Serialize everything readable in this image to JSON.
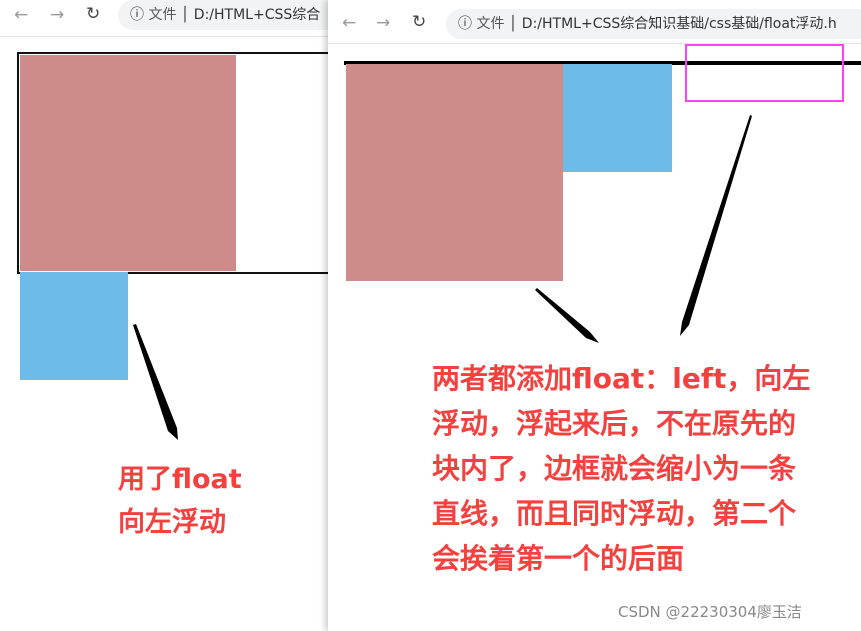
{
  "left_window": {
    "address_label": "文件",
    "address": "D:/HTML+CSS综合",
    "annotation": [
      "用了float",
      "向左浮动"
    ]
  },
  "right_window": {
    "address_label": "文件",
    "address": "D:/HTML+CSS综合知识基础/css基础/float浮动.h",
    "annotation": [
      "两者都添加float：left，向左",
      "浮动，浮起来后，不在原先的",
      "块内了，边框就会缩小为一条",
      "直线，而且同时浮动，第二个",
      "会挨着第一个的后面"
    ]
  },
  "colors": {
    "box1": "#cd8b8a",
    "box2": "#6cbbe8",
    "highlight": "#ff40ff",
    "annotation": "#f2413f"
  },
  "watermark": "CSDN @22230304廖玉洁"
}
